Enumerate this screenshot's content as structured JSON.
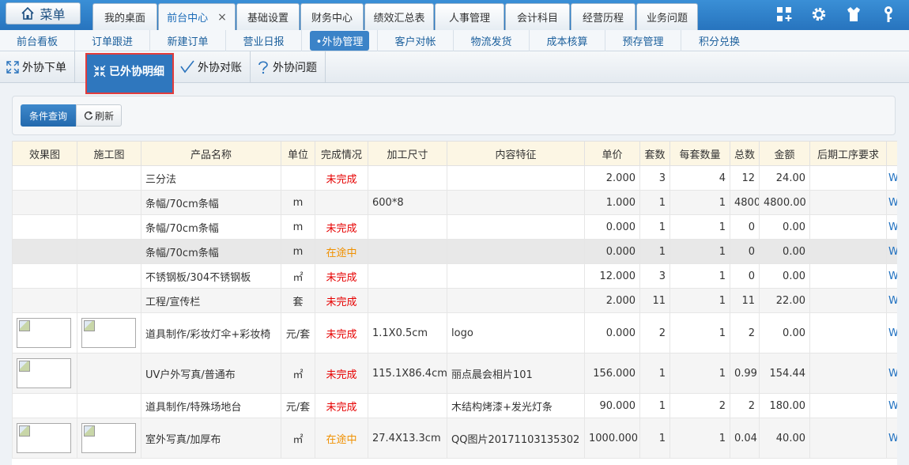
{
  "topbar": {
    "menu_label": "菜单",
    "tabs": [
      {
        "label": "我的桌面"
      },
      {
        "label": "前台中心",
        "active": true,
        "close": "×"
      },
      {
        "label": "基础设置"
      },
      {
        "label": "财务中心"
      },
      {
        "label": "绩效汇总表"
      },
      {
        "label": "人事管理"
      },
      {
        "label": "会计科目"
      },
      {
        "label": "经营历程"
      },
      {
        "label": "业务问题"
      }
    ],
    "icons": [
      "grid-plus-icon",
      "gear-icon",
      "shirt-icon",
      "key-icon"
    ]
  },
  "subnav": {
    "items": [
      "前台看板",
      "订单跟进",
      "新建订单",
      "营业日报",
      "•外协管理",
      "客户对帐",
      "物流发货",
      "成本核算",
      "预存管理",
      "积分兑换"
    ]
  },
  "subnav2": {
    "items": [
      {
        "label": "外协下单",
        "icon": "expand-icon"
      },
      {
        "label": "已外协明细",
        "icon": "collapse-icon",
        "active": true
      },
      {
        "label": "外协对账",
        "icon": "check-icon"
      },
      {
        "label": "外协问题",
        "icon": "question-icon"
      }
    ]
  },
  "toolbar": {
    "query_label": "条件查询",
    "refresh_label": "刷新"
  },
  "table": {
    "headers": [
      "效果图",
      "施工图",
      "产品名称",
      "单位",
      "完成情况",
      "加工尺寸",
      "内容特征",
      "单价",
      "套数",
      "每套数量",
      "总数",
      "金额",
      "后期工序要求"
    ],
    "rows": [
      {
        "eff": false,
        "con": false,
        "name": "三分法",
        "unit": "",
        "status": "未完成",
        "size": "",
        "content": "",
        "price": "2.000",
        "sets": "3",
        "per": "4",
        "total": "12",
        "amount": "24.00",
        "post": "",
        "link": "W"
      },
      {
        "eff": false,
        "con": false,
        "name": "条幅/70cm条幅",
        "unit": "m",
        "status": "",
        "size": "600*8",
        "content": "",
        "price": "1.000",
        "sets": "1",
        "per": "1",
        "total": "4800",
        "amount": "4800.00",
        "post": "",
        "link": "W"
      },
      {
        "eff": false,
        "con": false,
        "name": "条幅/70cm条幅",
        "unit": "m",
        "status": "未完成",
        "size": "",
        "content": "",
        "price": "0.000",
        "sets": "1",
        "per": "1",
        "total": "0",
        "amount": "0.00",
        "post": "",
        "link": "W"
      },
      {
        "eff": false,
        "con": false,
        "name": "条幅/70cm条幅",
        "unit": "m",
        "status": "在途中",
        "size": "",
        "content": "",
        "price": "0.000",
        "sets": "1",
        "per": "1",
        "total": "0",
        "amount": "0.00",
        "post": "",
        "link": "W"
      },
      {
        "eff": false,
        "con": false,
        "name": "不锈钢板/304不锈钢板",
        "unit": "㎡",
        "status": "未完成",
        "size": "",
        "content": "",
        "price": "12.000",
        "sets": "3",
        "per": "1",
        "total": "0",
        "amount": "0.00",
        "post": "",
        "link": "W"
      },
      {
        "eff": false,
        "con": false,
        "name": "工程/宣传栏",
        "unit": "套",
        "status": "未完成",
        "size": "",
        "content": "",
        "price": "2.000",
        "sets": "11",
        "per": "1",
        "total": "11",
        "amount": "22.00",
        "post": "",
        "link": "W"
      },
      {
        "eff": true,
        "con": true,
        "name": "道具制作/彩妆灯伞+彩妆椅",
        "unit": "元/套",
        "status": "未完成",
        "size": "1.1X0.5cm",
        "content": "logo",
        "price": "0.000",
        "sets": "2",
        "per": "1",
        "total": "2",
        "amount": "0.00",
        "post": "",
        "link": "W"
      },
      {
        "eff": true,
        "con": false,
        "name": "UV户外写真/普通布",
        "unit": "㎡",
        "status": "未完成",
        "size": "115.1X86.4cm",
        "content": "丽点晨会相片101",
        "price": "156.000",
        "sets": "1",
        "per": "1",
        "total": "0.99",
        "amount": "154.44",
        "post": "",
        "link": "W"
      },
      {
        "eff": false,
        "con": false,
        "name": "道具制作/特殊场地台",
        "unit": "元/套",
        "status": "未完成",
        "size": "",
        "content": "木结构烤漆+发光灯条",
        "price": "90.000",
        "sets": "1",
        "per": "2",
        "total": "2",
        "amount": "180.00",
        "post": "",
        "link": "W"
      },
      {
        "eff": true,
        "con": true,
        "name": "室外写真/加厚布",
        "unit": "㎡",
        "status": "在途中",
        "size": "27.4X13.3cm",
        "content": "QQ图片20171103135302",
        "price": "1000.000",
        "sets": "1",
        "per": "1",
        "total": "0.04",
        "amount": "40.00",
        "post": "",
        "link": "W"
      }
    ]
  }
}
